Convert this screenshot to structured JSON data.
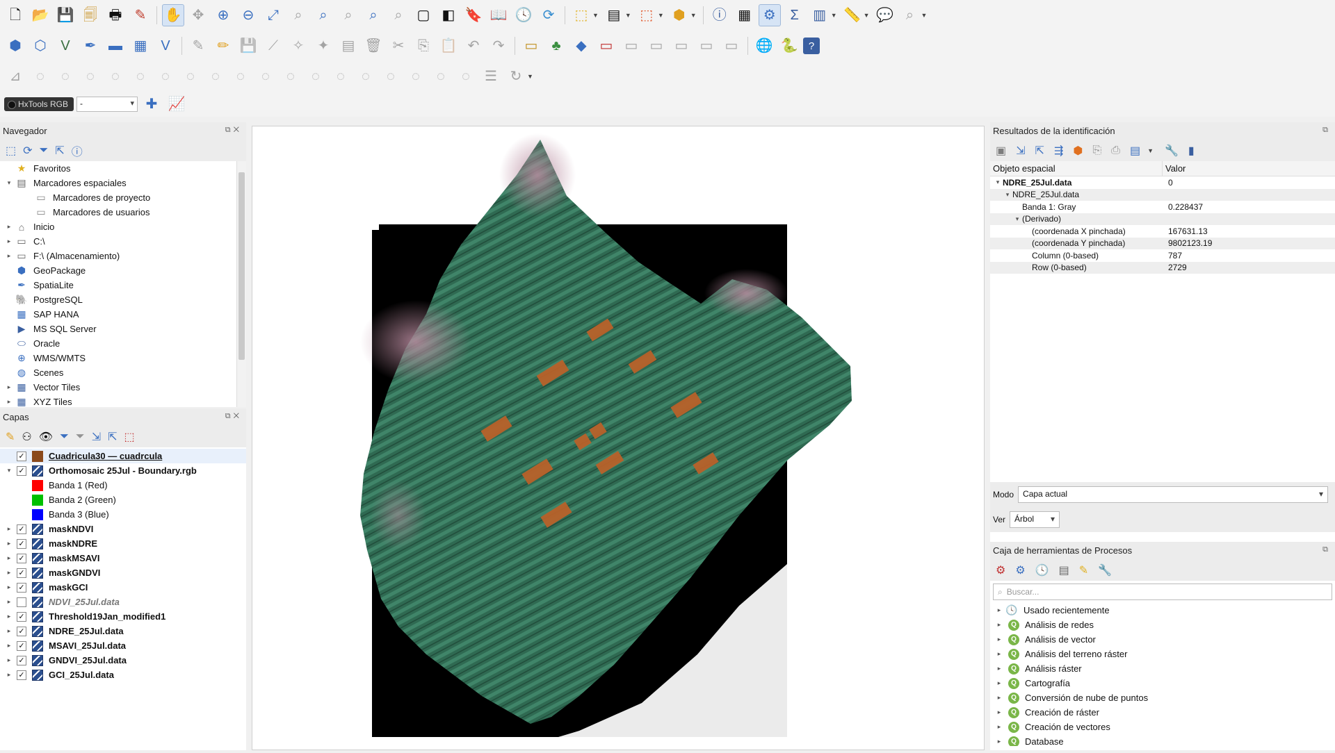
{
  "toolbar": {
    "hxtools_label": "HxTools RGB",
    "hxtools_value": "-"
  },
  "navigator": {
    "title": "Navegador",
    "items": [
      {
        "label": "Favoritos",
        "icon": "star-icon"
      },
      {
        "label": "Marcadores espaciales",
        "icon": "bookmark-icon"
      },
      {
        "label": "Marcadores de proyecto",
        "icon": "folder-icon"
      },
      {
        "label": "Marcadores de usuarios",
        "icon": "folder-icon"
      },
      {
        "label": "Inicio",
        "icon": "home-icon"
      },
      {
        "label": "C:\\",
        "icon": "drive-icon"
      },
      {
        "label": "F:\\ (Almacenamiento)",
        "icon": "drive-icon"
      },
      {
        "label": "GeoPackage",
        "icon": "geopackage-icon"
      },
      {
        "label": "SpatiaLite",
        "icon": "spatialite-icon"
      },
      {
        "label": "PostgreSQL",
        "icon": "postgresql-icon"
      },
      {
        "label": "SAP HANA",
        "icon": "sap-hana-icon"
      },
      {
        "label": "MS SQL Server",
        "icon": "mssql-icon"
      },
      {
        "label": "Oracle",
        "icon": "oracle-icon"
      },
      {
        "label": "WMS/WMTS",
        "icon": "wms-icon"
      },
      {
        "label": "Scenes",
        "icon": "scenes-icon"
      },
      {
        "label": "Vector Tiles",
        "icon": "vector-tiles-icon"
      },
      {
        "label": "XYZ Tiles",
        "icon": "xyz-tiles-icon"
      }
    ]
  },
  "layers": {
    "title": "Capas",
    "items": [
      {
        "label": "Cuadricula30 — cuadrcula",
        "checked": true,
        "type": "polygon",
        "color": "#8b4a1c"
      },
      {
        "label": "Orthomosaic 25Jul - Boundary.rgb",
        "checked": true,
        "type": "raster",
        "expanded": true
      },
      {
        "label": "Banda 1 (Red)",
        "type": "band",
        "color": "#ff0000"
      },
      {
        "label": "Banda 2 (Green)",
        "type": "band",
        "color": "#00c000"
      },
      {
        "label": "Banda 3 (Blue)",
        "type": "band",
        "color": "#0000ff"
      },
      {
        "label": "maskNDVI",
        "checked": true,
        "type": "raster"
      },
      {
        "label": "maskNDRE",
        "checked": true,
        "type": "raster"
      },
      {
        "label": "maskMSAVI",
        "checked": true,
        "type": "raster"
      },
      {
        "label": "maskGNDVI",
        "checked": true,
        "type": "raster"
      },
      {
        "label": "maskGCI",
        "checked": true,
        "type": "raster"
      },
      {
        "label": "NDVI_25Jul.data",
        "checked": false,
        "type": "raster"
      },
      {
        "label": "Threshold19Jan_modified1",
        "checked": true,
        "type": "raster"
      },
      {
        "label": "NDRE_25Jul.data",
        "checked": true,
        "type": "raster"
      },
      {
        "label": "MSAVI_25Jul.data",
        "checked": true,
        "type": "raster"
      },
      {
        "label": "GNDVI_25Jul.data",
        "checked": true,
        "type": "raster"
      },
      {
        "label": "GCI_25Jul.data",
        "checked": true,
        "type": "raster"
      }
    ]
  },
  "identify": {
    "title": "Resultados de la identificación",
    "col_feature": "Objeto espacial",
    "col_value": "Valor",
    "rows": [
      {
        "label": "NDRE_25Jul.data",
        "value": "0",
        "level": 0,
        "bold": true,
        "arrow": "▾"
      },
      {
        "label": "NDRE_25Jul.data",
        "value": "",
        "level": 1,
        "arrow": "▾"
      },
      {
        "label": "Banda 1: Gray",
        "value": "0.228437",
        "level": 2,
        "arrow": ""
      },
      {
        "label": "(Derivado)",
        "value": "",
        "level": 2,
        "arrow": "▾"
      },
      {
        "label": "(coordenada X pinchada)",
        "value": "167631.13",
        "level": 3,
        "arrow": ""
      },
      {
        "label": "(coordenada Y pinchada)",
        "value": "9802123.19",
        "level": 3,
        "arrow": ""
      },
      {
        "label": "Column (0-based)",
        "value": "787",
        "level": 3,
        "arrow": ""
      },
      {
        "label": "Row (0-based)",
        "value": "2729",
        "level": 3,
        "arrow": ""
      }
    ],
    "mode_label": "Modo",
    "mode_value": "Capa actual",
    "view_label": "Ver",
    "view_value": "Árbol"
  },
  "processing": {
    "title": "Caja de herramientas de Procesos",
    "search_placeholder": "Buscar...",
    "items": [
      {
        "label": "Usado recientemente",
        "icon": "clock-icon"
      },
      {
        "label": "Análisis de redes",
        "icon": "qgis-icon"
      },
      {
        "label": "Análisis de vector",
        "icon": "qgis-icon"
      },
      {
        "label": "Análisis del terreno ráster",
        "icon": "qgis-icon"
      },
      {
        "label": "Análisis ráster",
        "icon": "qgis-icon"
      },
      {
        "label": "Cartografía",
        "icon": "qgis-icon"
      },
      {
        "label": "Conversión de nube de puntos",
        "icon": "qgis-icon"
      },
      {
        "label": "Creación de ráster",
        "icon": "qgis-icon"
      },
      {
        "label": "Creación de vectores",
        "icon": "qgis-icon"
      },
      {
        "label": "Database",
        "icon": "qgis-icon"
      }
    ]
  },
  "colors": {
    "field_green": "#2f6a52",
    "plot_orange": "#b8622a",
    "raster_black": "#000000"
  }
}
